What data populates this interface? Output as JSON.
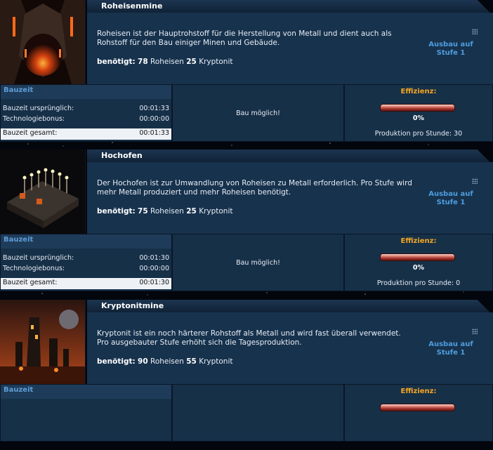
{
  "buildings": [
    {
      "name": "Roheisenmine",
      "description": "Roheisen ist der Hauptrohstoff für die Herstellung von Metall und dient auch als Rohstoff für den Bau einiger Minen und Gebäude.",
      "requires_label": "benötigt:",
      "requires_roheisen": "78",
      "roheisen_label": "Roheisen",
      "requires_kryptonit": "25",
      "kryptonit_label": "Kryptonit",
      "upgrade_link": "Ausbau auf Stufe 1",
      "bauzeit_header": "Bauzeit",
      "bauzeit_original_label": "Bauzeit ursprünglich:",
      "bauzeit_original_value": "00:01:33",
      "tech_bonus_label": "Technologiebonus:",
      "tech_bonus_value": "00:00:00",
      "bauzeit_total_label": "Bauzeit gesamt:",
      "bauzeit_total_value": "00:01:33",
      "build_status": "Bau möglich!",
      "efficiency_label": "Effizienz:",
      "efficiency_pct": "0%",
      "production_label": "Produktion pro Stunde: 30"
    },
    {
      "name": "Hochofen",
      "description": "Der Hochofen ist zur Umwandlung von Roheisen zu Metall erforderlich. Pro Stufe wird mehr Metall produziert und mehr Roheisen benötigt.",
      "requires_label": "benötigt:",
      "requires_roheisen": "75",
      "roheisen_label": "Roheisen",
      "requires_kryptonit": "25",
      "kryptonit_label": "Kryptonit",
      "upgrade_link": "Ausbau auf Stufe 1",
      "bauzeit_header": "Bauzeit",
      "bauzeit_original_label": "Bauzeit ursprünglich:",
      "bauzeit_original_value": "00:01:30",
      "tech_bonus_label": "Technologiebonus:",
      "tech_bonus_value": "00:00:00",
      "bauzeit_total_label": "Bauzeit gesamt:",
      "bauzeit_total_value": "00:01:30",
      "build_status": "Bau möglich!",
      "efficiency_label": "Effizienz:",
      "efficiency_pct": "0%",
      "production_label": "Produktion pro Stunde: 0"
    },
    {
      "name": "Kryptonitmine",
      "description": "Kryptonit ist ein noch härterer Rohstoff als Metall und wird fast überall verwendet. Pro ausgebauter Stufe erhöht sich die Tagesproduktion.",
      "requires_label": "benötigt:",
      "requires_roheisen": "90",
      "roheisen_label": "Roheisen",
      "requires_kryptonit": "55",
      "kryptonit_label": "Kryptonit",
      "upgrade_link": "Ausbau auf Stufe 1",
      "bauzeit_header": "Bauzeit",
      "efficiency_label": "Effizienz:"
    }
  ],
  "icons": [
    "lava-mine-image",
    "blast-furnace-image",
    "kryptonite-mine-image",
    "grip-icon"
  ]
}
